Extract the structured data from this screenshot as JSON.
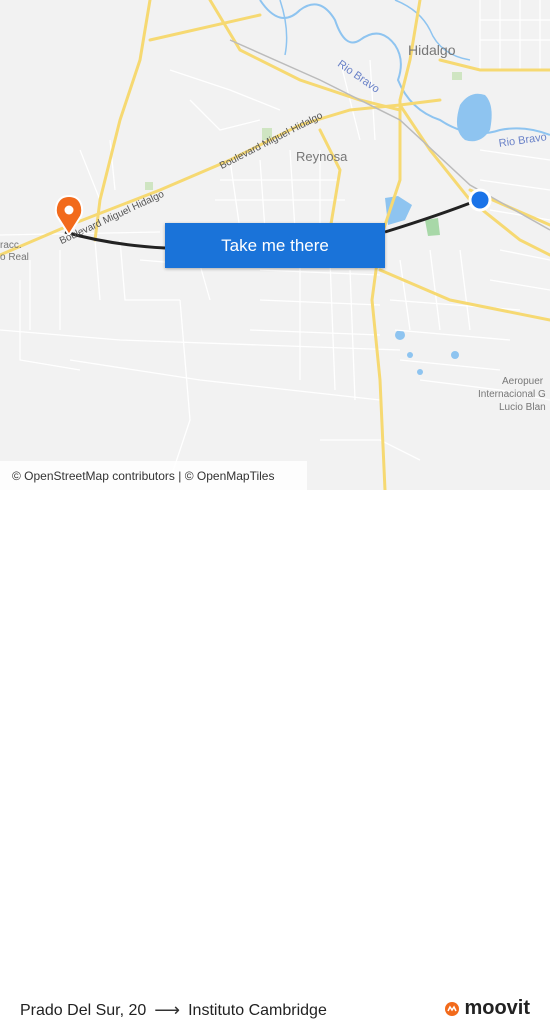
{
  "map": {
    "labels": {
      "hidalgo": "Hidalgo",
      "reynosa": "Reynosa",
      "rio_bravo_1": "Rio Bravo",
      "rio_bravo_2": "Rio Bravo",
      "boulevard_1": "Boulevard Miguel Hidalgo",
      "boulevard_2": "Boulevard Miguel Hidalgo",
      "fracc_1": "racc.",
      "fracc_2": "o Real",
      "airport_1": "Aeropuer",
      "airport_2": "Internacional G",
      "airport_3": "Lucio Blan"
    },
    "colors": {
      "road_major": "#f6d972",
      "road_minor": "#ffffff",
      "water": "#8ec4f0",
      "route_line": "#222222",
      "destination_pin": "#f26a1b",
      "origin_dot": "#1a73e8"
    }
  },
  "cta": {
    "label": "Take me there"
  },
  "attribution": {
    "text": "© OpenStreetMap contributors | © OpenMapTiles"
  },
  "footer": {
    "origin": "Prado Del Sur, 20",
    "arrow": "⟶",
    "destination": "Instituto Cambridge",
    "brand": "moovit"
  }
}
